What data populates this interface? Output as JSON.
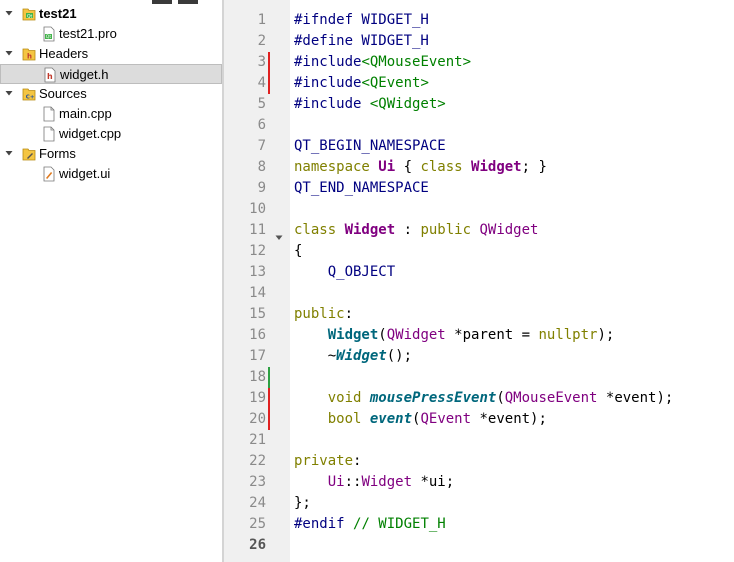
{
  "project_tree": [
    {
      "label": "test21",
      "bold": true,
      "expanded": true,
      "icon": "qt-project-icon",
      "depth": 0
    },
    {
      "label": "test21.pro",
      "depth": 1,
      "icon": "pro-file-icon"
    },
    {
      "label": "Headers",
      "depth": 0,
      "expanded": true,
      "icon": "headers-folder-icon"
    },
    {
      "label": "widget.h",
      "depth": 1,
      "icon": "header-file-icon",
      "selected": true
    },
    {
      "label": "Sources",
      "depth": 0,
      "expanded": true,
      "icon": "sources-folder-icon"
    },
    {
      "label": "main.cpp",
      "depth": 1,
      "icon": "cpp-file-icon"
    },
    {
      "label": "widget.cpp",
      "depth": 1,
      "icon": "cpp-file-icon"
    },
    {
      "label": "Forms",
      "depth": 0,
      "expanded": true,
      "icon": "forms-folder-icon"
    },
    {
      "label": "widget.ui",
      "depth": 1,
      "icon": "ui-file-icon"
    }
  ],
  "current_line": 26,
  "change_markers": {
    "modified": [
      3,
      4,
      19,
      20
    ],
    "added": [
      18
    ]
  },
  "foldable_lines": [
    11
  ],
  "colors": {
    "modified": "#e02020",
    "added": "#2ea043",
    "keyword": "#808000",
    "type": "#800080",
    "function": "#00677c",
    "preprocessor": "#000080",
    "include_path": "#008000"
  },
  "code_lines": [
    [
      [
        "pp",
        "#ifndef WIDGET_H"
      ]
    ],
    [
      [
        "pp",
        "#define WIDGET_H"
      ]
    ],
    [
      [
        "pp",
        "#include"
      ],
      [
        "inc",
        "<QMouseEvent>"
      ]
    ],
    [
      [
        "pp",
        "#include"
      ],
      [
        "inc",
        "<QEvent>"
      ]
    ],
    [
      [
        "pp",
        "#include "
      ],
      [
        "inc",
        "<QWidget>"
      ]
    ],
    [],
    [
      [
        "mac",
        "QT_BEGIN_NAMESPACE"
      ]
    ],
    [
      [
        "kw",
        "namespace "
      ],
      [
        "tyb",
        "Ui"
      ],
      [
        "pl",
        " { "
      ],
      [
        "kw",
        "class "
      ],
      [
        "tyb",
        "Widget"
      ],
      [
        "pl",
        "; }"
      ]
    ],
    [
      [
        "mac",
        "QT_END_NAMESPACE"
      ]
    ],
    [],
    [
      [
        "kw",
        "class "
      ],
      [
        "tyb",
        "Widget"
      ],
      [
        "pl",
        " : "
      ],
      [
        "kw",
        "public "
      ],
      [
        "ty",
        "QWidget"
      ]
    ],
    [
      [
        "pl",
        "{"
      ]
    ],
    [
      [
        "pl",
        "    "
      ],
      [
        "mac",
        "Q_OBJECT"
      ]
    ],
    [],
    [
      [
        "kw",
        "public"
      ],
      [
        "pl",
        ":"
      ]
    ],
    [
      [
        "pl",
        "    "
      ],
      [
        "fn",
        "Widget"
      ],
      [
        "pl",
        "("
      ],
      [
        "ty",
        "QWidget"
      ],
      [
        "pl",
        " *parent = "
      ],
      [
        "kw",
        "nullptr"
      ],
      [
        "pl",
        ");"
      ]
    ],
    [
      [
        "pl",
        "    ~"
      ],
      [
        "fni",
        "Widget"
      ],
      [
        "pl",
        "();"
      ]
    ],
    [],
    [
      [
        "pl",
        "    "
      ],
      [
        "kw",
        "void "
      ],
      [
        "fni",
        "mousePressEvent"
      ],
      [
        "pl",
        "("
      ],
      [
        "ty",
        "QMouseEvent"
      ],
      [
        "pl",
        " *event);"
      ]
    ],
    [
      [
        "pl",
        "    "
      ],
      [
        "kw",
        "bool "
      ],
      [
        "fni",
        "event"
      ],
      [
        "pl",
        "("
      ],
      [
        "ty",
        "QEvent"
      ],
      [
        "pl",
        " *event);"
      ]
    ],
    [],
    [
      [
        "kw",
        "private"
      ],
      [
        "pl",
        ":"
      ]
    ],
    [
      [
        "pl",
        "    "
      ],
      [
        "ty",
        "Ui"
      ],
      [
        "pl",
        "::"
      ],
      [
        "ty",
        "Widget"
      ],
      [
        "pl",
        " *ui;"
      ]
    ],
    [
      [
        "pl",
        "};"
      ]
    ],
    [
      [
        "pp",
        "#endif "
      ],
      [
        "cm",
        "// WIDGET_H"
      ]
    ],
    []
  ]
}
